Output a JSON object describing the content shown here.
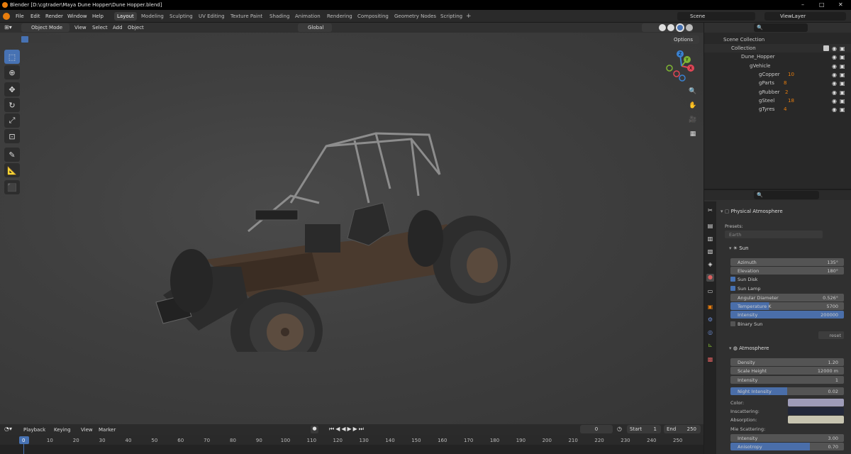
{
  "window": {
    "title": "Blender [D:\\cgtrader\\Maya Dune Hopper\\Dune Hopper.blend]",
    "controls": [
      "–",
      "□",
      "✕"
    ]
  },
  "menu": [
    "File",
    "Edit",
    "Render",
    "Window",
    "Help"
  ],
  "workspaces": [
    "Layout",
    "Modeling",
    "Sculpting",
    "UV Editing",
    "Texture Paint",
    "Shading",
    "Animation",
    "Rendering",
    "Compositing",
    "Geometry Nodes",
    "Scripting",
    "+"
  ],
  "active_workspace": "Layout",
  "scene": {
    "label": "Scene",
    "view_layer": "ViewLayer"
  },
  "viewport_header": {
    "mode": "Object Mode",
    "menus": [
      "View",
      "Select",
      "Add",
      "Object"
    ],
    "orientation": "Global",
    "options": "Options"
  },
  "gizmo_axes": {
    "x": "X",
    "y": "Y",
    "z": "Z"
  },
  "outliner": {
    "root": "Scene Collection",
    "collection": "Collection",
    "objects": [
      {
        "name": "Dune_Hopper",
        "depth": 0
      },
      {
        "name": "gVehicle",
        "depth": 1
      },
      {
        "name": "gCopper",
        "depth": 2,
        "count": "10"
      },
      {
        "name": "gParts",
        "depth": 2,
        "count": "8"
      },
      {
        "name": "gRubber",
        "depth": 2,
        "count": "2"
      },
      {
        "name": "gSteel",
        "depth": 2,
        "count": "18"
      },
      {
        "name": "gTyres",
        "depth": 2,
        "count": "4"
      }
    ]
  },
  "properties": {
    "panel_title": "Physical Atmosphere",
    "presets_label": "Presets:",
    "preset_value": "Earth",
    "sun": {
      "header": "Sun",
      "azimuth": {
        "label": "Azimuth",
        "value": "135°"
      },
      "elevation": {
        "label": "Elevation",
        "value": "180°"
      },
      "sun_disk": "Sun Disk",
      "sun_lamp": "Sun Lamp",
      "angular_diameter": {
        "label": "Angular Diameter",
        "value": "0.526°"
      },
      "temperature": {
        "label": "Temperature K",
        "value": "5700",
        "fill": 0.34
      },
      "intensity": {
        "label": "Intensity",
        "value": "200000",
        "fill": 1.0
      },
      "binary_sun": "Binary Sun",
      "reset": "reset"
    },
    "atmosphere": {
      "header": "Atmosphere",
      "density": {
        "label": "Density",
        "value": "1.20"
      },
      "scale_height": {
        "label": "Scale Height",
        "value": "12000 m"
      },
      "intensity": {
        "label": "Intensity",
        "value": "1"
      },
      "night_intensity": {
        "label": "Night Intensity",
        "value": "0.02",
        "fill": 0.5
      },
      "color": {
        "label": "Color:",
        "hex": "#9e9cb8"
      },
      "inscattering": {
        "label": "Inscattering:",
        "hex": "#23283a"
      },
      "absorption": {
        "label": "Absorption:",
        "hex": "#c7c4b0"
      },
      "mie_label": "Mie Scattering:",
      "mie_intensity": {
        "label": "Intensity",
        "value": "3.00"
      },
      "anisotropy": {
        "label": "Anisotropy",
        "value": "0.70",
        "fill": 0.7
      }
    }
  },
  "timeline": {
    "menus": [
      "Playback",
      "Keying",
      "View",
      "Marker"
    ],
    "current_frame": "0",
    "start_label": "Start",
    "start": "1",
    "end_label": "End",
    "end": "250",
    "ticks": [
      "0",
      "10",
      "20",
      "30",
      "40",
      "50",
      "60",
      "70",
      "80",
      "90",
      "100",
      "110",
      "120",
      "130",
      "140",
      "150",
      "160",
      "170",
      "180",
      "190",
      "200",
      "210",
      "220",
      "230",
      "240",
      "250"
    ]
  },
  "colors": {
    "accent": "#4772b3",
    "x_axis": "#e04656",
    "y_axis": "#7fb533",
    "z_axis": "#3b82d1",
    "blender_orange": "#e87d0d"
  },
  "icons": [
    "blender-logo-icon",
    "select-box-icon",
    "cursor-icon",
    "move-icon",
    "rotate-icon",
    "scale-icon",
    "transform-icon",
    "annotate-icon",
    "measure-icon",
    "add-cube-icon",
    "zoom-icon",
    "hand-icon",
    "camera-icon",
    "grid-icon",
    "eye-icon",
    "camera-render-icon",
    "sun-icon",
    "world-icon"
  ]
}
